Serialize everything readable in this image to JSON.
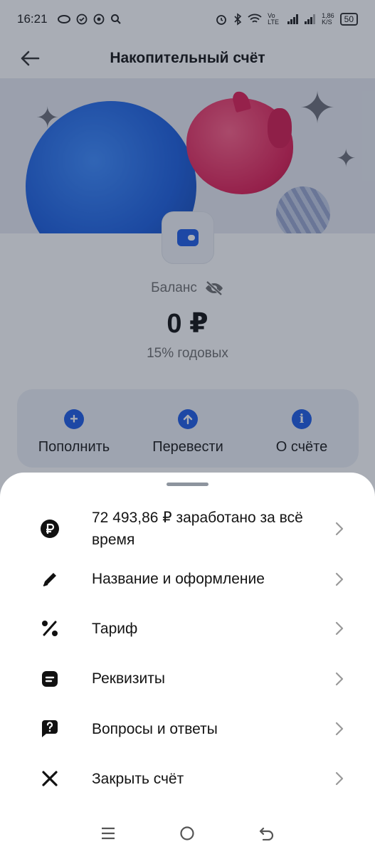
{
  "status_bar": {
    "time": "16:21",
    "network_speed": "1,86",
    "network_unit": "K/S",
    "carrier": "Vo LTE",
    "battery": "50"
  },
  "header": {
    "title": "Накопительный счёт"
  },
  "balance": {
    "label": "Баланс",
    "amount": "0 ₽",
    "rate": "15% годовых"
  },
  "actions": [
    {
      "label": "Пополнить",
      "icon": "plus-circle-icon"
    },
    {
      "label": "Перевести",
      "icon": "arrow-up-circle-icon"
    },
    {
      "label": "О счёте",
      "icon": "info-circle-icon"
    }
  ],
  "sheet": {
    "items": [
      {
        "label": "72 493,86 ₽ заработано за всё время",
        "icon": "ruble-coin-icon"
      },
      {
        "label": "Название и оформление",
        "icon": "pencil-icon"
      },
      {
        "label": "Тариф",
        "icon": "percent-icon"
      },
      {
        "label": "Реквизиты",
        "icon": "document-icon"
      },
      {
        "label": "Вопросы и ответы",
        "icon": "question-bubble-icon"
      },
      {
        "label": "Закрыть счёт",
        "icon": "close-icon"
      }
    ]
  },
  "colors": {
    "accent": "#1e5ce6",
    "dim_overlay": "rgba(30,40,60,0.38)"
  }
}
